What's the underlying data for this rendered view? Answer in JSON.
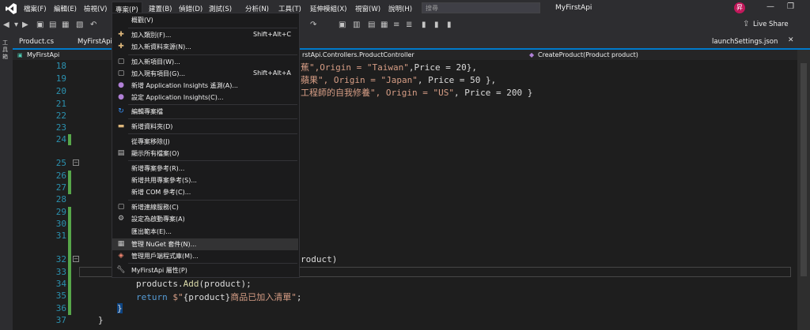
{
  "menubar": {
    "items": [
      "檔案(F)",
      "編輯(E)",
      "檢視(V)",
      "專案(P)",
      "建置(B)",
      "偵錯(D)",
      "測試(S)",
      "分析(N)",
      "工具(T)",
      "延伸模組(X)",
      "視窗(W)",
      "說明(H)"
    ]
  },
  "search": {
    "placeholder": "搜尋"
  },
  "app": {
    "title": "MyFirstApi",
    "avatar_initial": "昇"
  },
  "window": {
    "minimize": "—",
    "restore": "❐"
  },
  "toolbar": {
    "live_share": "Live Share"
  },
  "side_strip": {
    "label": "工具箱"
  },
  "tabs": [
    "Product.cs",
    "MyFirstApi",
    "launchSettings.json"
  ],
  "navbar": {
    "project": "MyFirstApi",
    "class": "rstApi.Controllers.ProductController",
    "member": "CreateProduct(Product product)"
  },
  "project_menu": {
    "items": [
      {
        "label": "概觀(V)",
        "shortcut": "",
        "icon": "none"
      },
      {
        "label": "加入類別(F)...",
        "shortcut": "Shift+Alt+C",
        "icon": "add-class-icon"
      },
      {
        "label": "加入新資料來源(N)...",
        "shortcut": "",
        "icon": "add-datasource-icon"
      },
      {
        "label": "加入新項目(W)...",
        "shortcut": "",
        "icon": "add-new-item-icon"
      },
      {
        "label": "加入現有項目(G)...",
        "shortcut": "Shift+Alt+A",
        "icon": "add-existing-item-icon"
      },
      {
        "label": "新增 Application Insights 遙測(A)...",
        "shortcut": "",
        "icon": "app-insights-icon"
      },
      {
        "label": "設定 Application Insights(C)...",
        "shortcut": "",
        "icon": "app-insights-settings-icon"
      },
      {
        "label": "編輯專案檔",
        "shortcut": "",
        "icon": "refresh-icon"
      },
      {
        "label": "新增資料夾(D)",
        "shortcut": "",
        "icon": "folder-icon"
      },
      {
        "label": "從專案移除(J)",
        "shortcut": "",
        "icon": "none"
      },
      {
        "label": "顯示所有檔案(O)",
        "shortcut": "",
        "icon": "show-all-files-icon"
      },
      {
        "label": "新增專案參考(R)...",
        "shortcut": "",
        "icon": "none"
      },
      {
        "label": "新增共用專案參考(S)...",
        "shortcut": "",
        "icon": "none"
      },
      {
        "label": "新增 COM 參考(C)...",
        "shortcut": "",
        "icon": "none"
      },
      {
        "label": "新增連線服務(C)",
        "shortcut": "",
        "icon": "connected-service-icon"
      },
      {
        "label": "設定為啟動專案(A)",
        "shortcut": "",
        "icon": "gear-icon"
      },
      {
        "label": "匯出範本(E)...",
        "shortcut": "",
        "icon": "none"
      },
      {
        "label": "管理 NuGet 套件(N)...",
        "shortcut": "",
        "icon": "nuget-icon"
      },
      {
        "label": "管理用戶端程式庫(M)...",
        "shortcut": "",
        "icon": "client-library-icon"
      },
      {
        "label": "MyFirstApi 屬性(P)",
        "shortcut": "",
        "icon": "wrench-icon"
      }
    ]
  },
  "editor": {
    "line_numbers": [
      "18",
      "19",
      "20",
      "21",
      "22",
      "23",
      "24",
      "25",
      "26",
      "27",
      "28",
      "29",
      "30",
      "31",
      "32",
      "33",
      "34",
      "35",
      "36",
      "37"
    ],
    "line18": {
      "text1": "蕉\",Origin = ",
      "str": "\"Taiwan\"",
      "text2": ",Price = 20},"
    },
    "line19": {
      "text1": "蘋果\", Origin = ",
      "str": "\"Japan\"",
      "text2": ", Price = 50 },"
    },
    "line20": {
      "text1": "工程師的自我修養\", Origin = ",
      "str": "\"US\"",
      "text2": ", Price = 200 }"
    },
    "line32": "roduct)",
    "line34": {
      "obj": "products",
      "method": "Add",
      "arg": "(product);"
    },
    "line35": {
      "kw": "return",
      "prefix": " $\"",
      "interp": "{product}",
      "str": "商品已加入清單\"",
      "end": ";"
    },
    "line36": "}",
    "line37": "}"
  }
}
